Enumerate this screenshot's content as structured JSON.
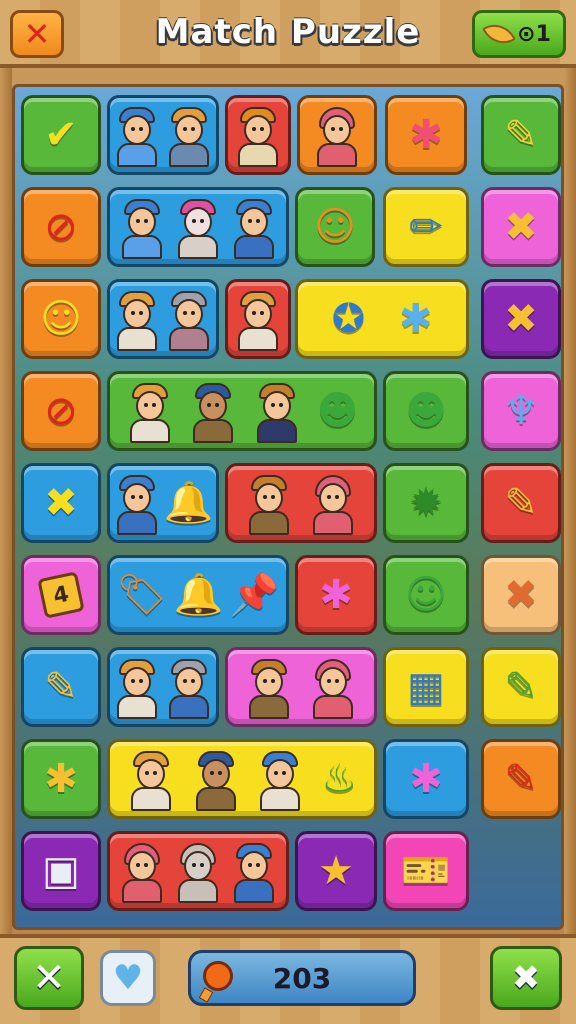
{
  "header": {
    "title": "Match Puzzle",
    "close_icon": "close-x-icon",
    "currency_icon": "leaf-icon",
    "currency_value": "1",
    "currency_prefix": "⊙"
  },
  "board": {
    "rows": [
      [
        "check-badge",
        "worker-pair",
        "worker-helmet",
        "worker-woman",
        "pink-blob",
        "pencil"
      ],
      [
        "no-sign",
        "worker-trio",
        "smiley-pin",
        "marker",
        "cross-tool"
      ],
      [
        "smiley-yellow",
        "worker-pair-b",
        "worker-old",
        "compass-blob",
        "ruler-purple"
      ],
      [
        "no-sign-red",
        "worker-trio-green",
        "green-blob",
        "push-pin"
      ],
      [
        "x-cross",
        "worker-bell",
        "worker-duo-red",
        "gear-badge",
        "pencil-red"
      ],
      [
        "tag-4",
        "tag-key-bell",
        "pink-pin",
        "green-smiley",
        "ruler-peach"
      ],
      [
        "pencil-blue",
        "worker-pair-c",
        "worker-duo-pink",
        "eraser-tool",
        "pencil-green"
      ],
      [
        "star-blob",
        "worker-trio-yellow",
        "candy-pin",
        "pencil-orange"
      ],
      [
        "dispenser",
        "worker-trio-red",
        "star-wand",
        "ticket"
      ]
    ],
    "tile_4_label": "4"
  },
  "footer": {
    "left_button_icon": "x-icon",
    "heart_button_icon": "heart-icon",
    "score_value": "203",
    "score_icon": "pin-icon",
    "right_button_icon": "tools-icon"
  }
}
